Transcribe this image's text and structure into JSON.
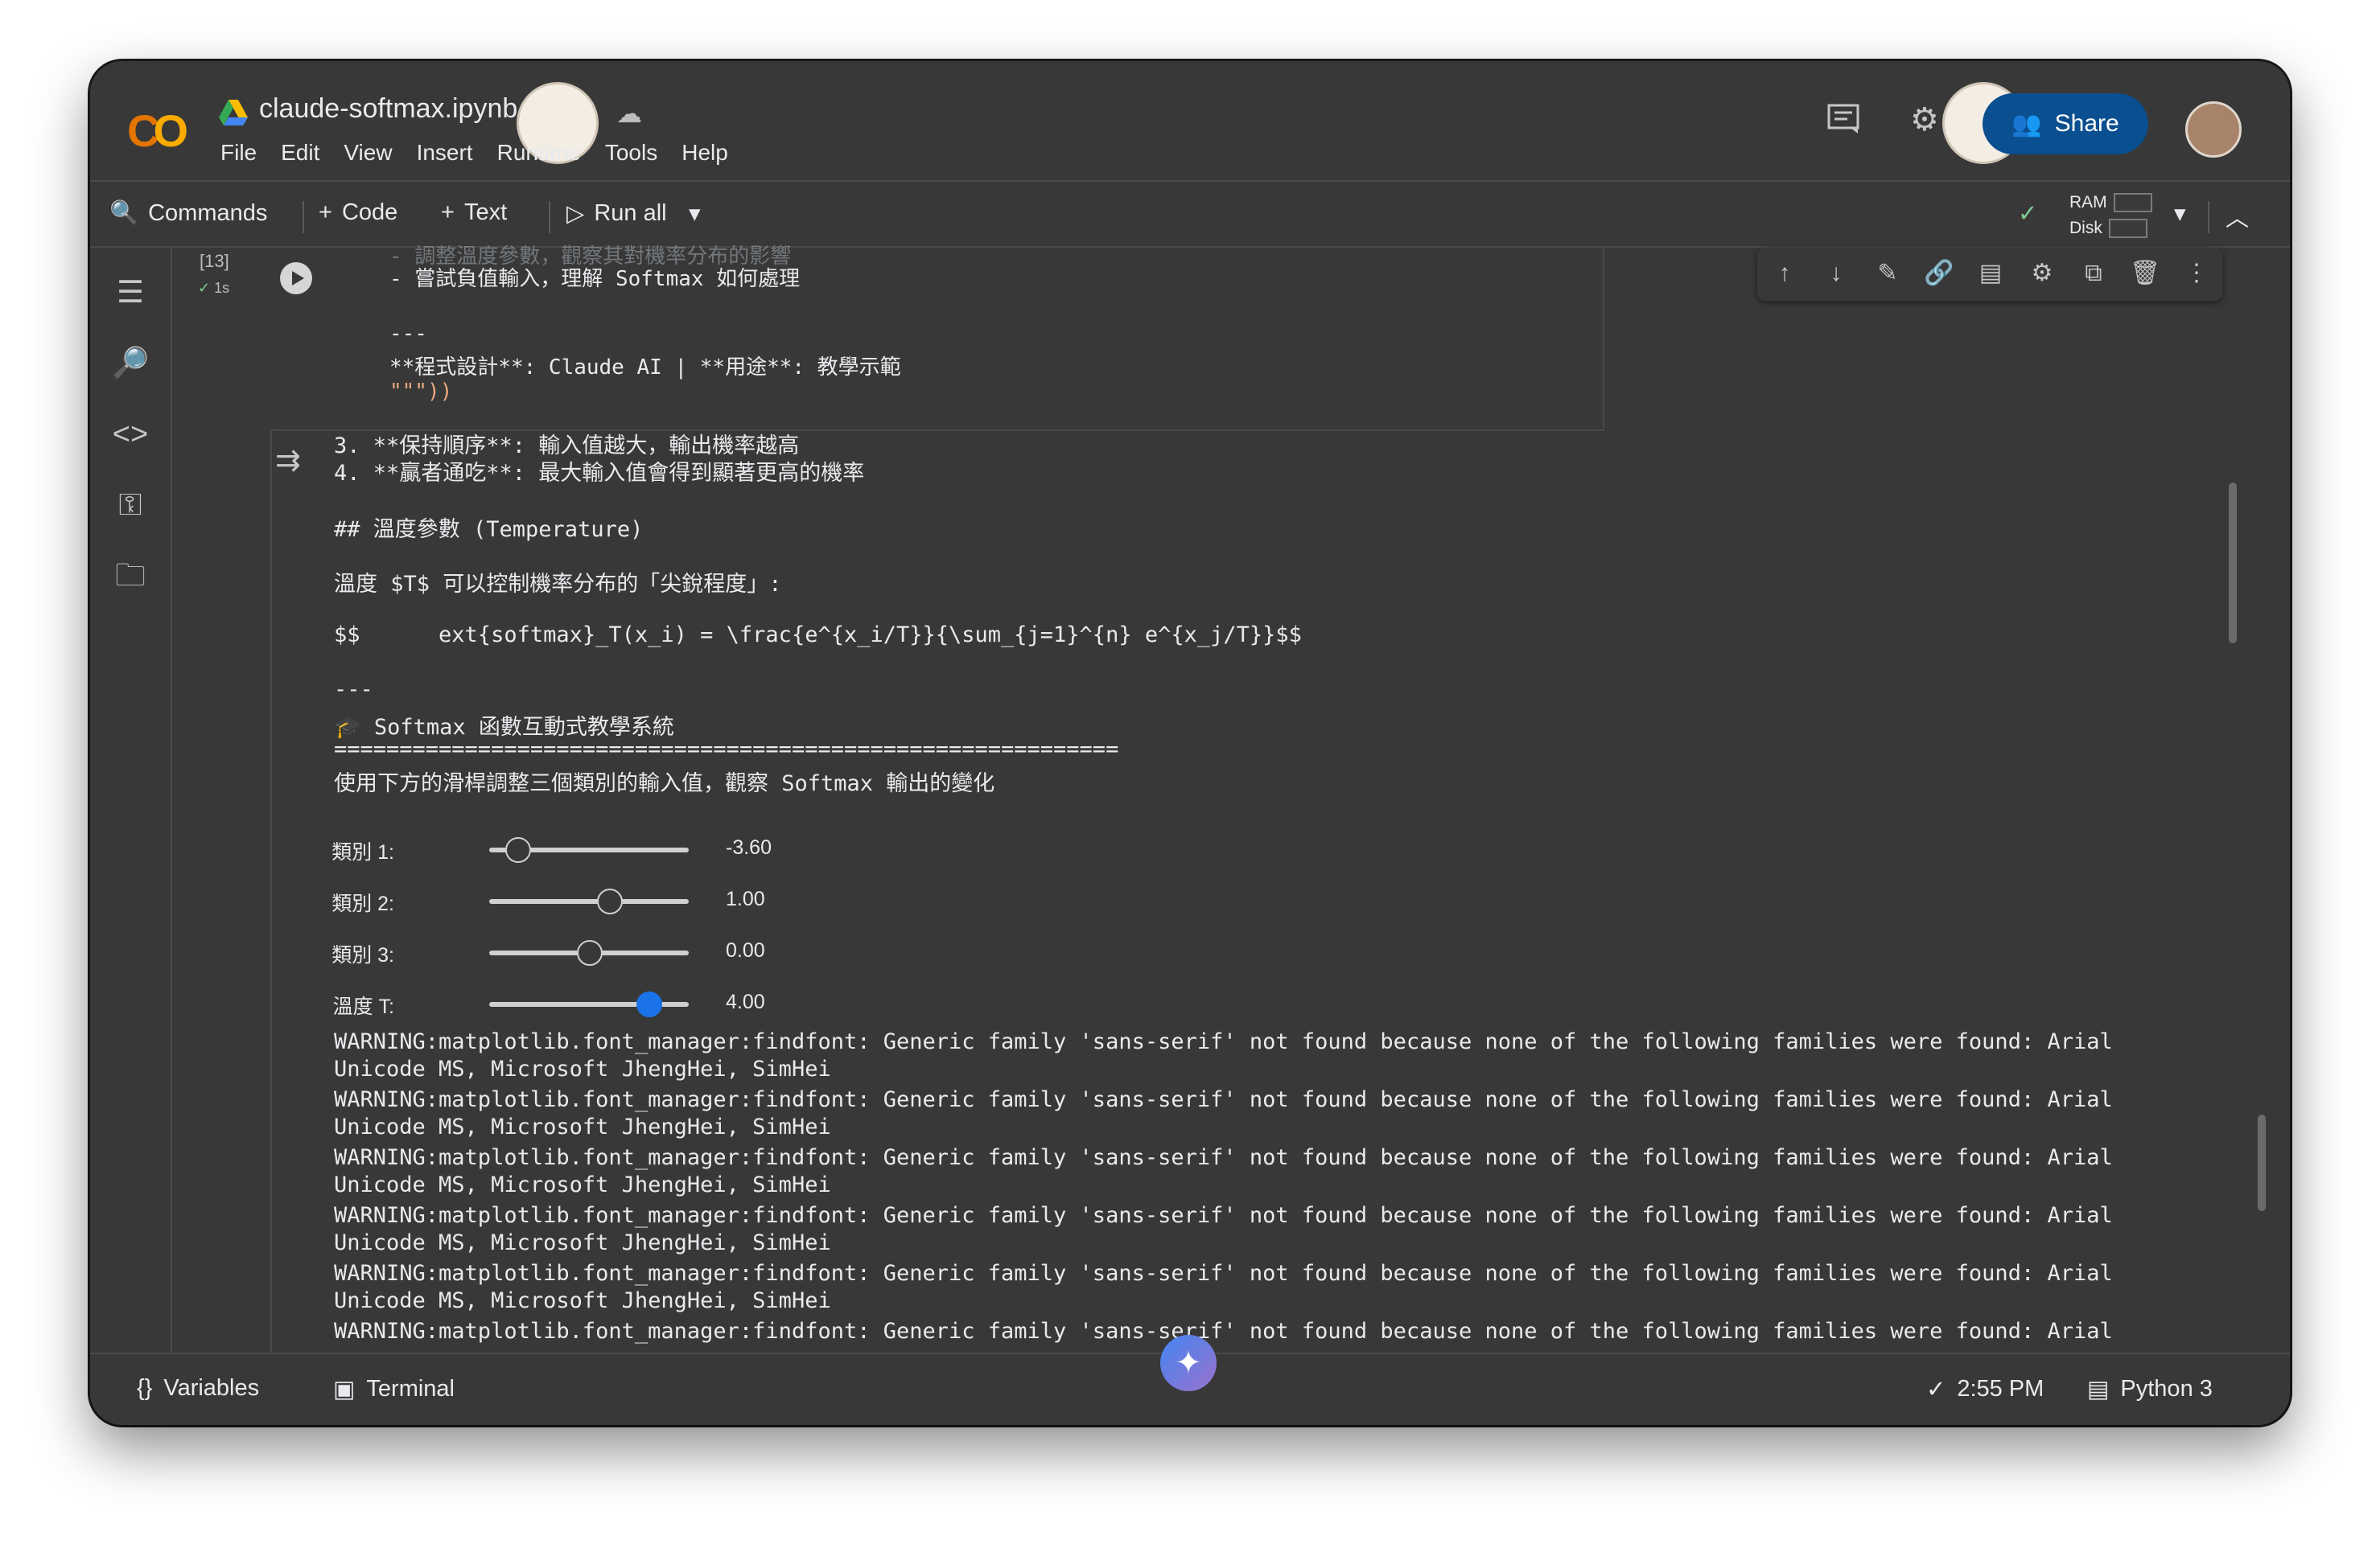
{
  "header": {
    "filename": "claude-softmax.ipynb",
    "menu": [
      "File",
      "Edit",
      "View",
      "Insert",
      "Runtime",
      "Tools",
      "Help"
    ],
    "share_label": "Share"
  },
  "toolbar": {
    "commands": "Commands",
    "code": "Code",
    "text": "Text",
    "run_all": "Run all",
    "ram": "RAM",
    "disk": "Disk"
  },
  "cell": {
    "exec_count": "[13]",
    "exec_time": "1s",
    "code_lines": [
      "- 調整溫度參數，觀察其對機率分布的影響",
      "- 嘗試負值輸入，理解 Softmax 如何處理",
      "",
      "---",
      "**程式設計**: Claude AI | **用途**: 教學示範",
      "\"\"\"))"
    ]
  },
  "output": {
    "lines": [
      "3. **保持順序**: 輸入值越大，輸出機率越高",
      "4. **贏者通吃**: 最大輸入值會得到顯著更高的機率",
      "## 溫度參數 (Temperature)",
      "溫度 $T$ 可以控制機率分布的「尖銳程度」:",
      "$$      ext{softmax}_T(x_i) = \\frac{e^{x_i/T}}{\\sum_{j=1}^{n} e^{x_j/T}}$$",
      "---",
      "🎓 Softmax 函數互動式教學系統",
      "============================================================",
      "使用下方的滑桿調整三個類別的輸入值，觀察 Softmax 輸出的變化"
    ],
    "sliders": [
      {
        "label": "類別 1:",
        "value": "-3.60",
        "fraction": 0.14
      },
      {
        "label": "類別 2:",
        "value": "1.00",
        "fraction": 0.6
      },
      {
        "label": "類別 3:",
        "value": "0.00",
        "fraction": 0.5
      },
      {
        "label": "溫度 T:",
        "value": "4.00",
        "fraction": 0.8
      }
    ],
    "warnings": [
      "WARNING:matplotlib.font_manager:findfont: Generic family 'sans-serif' not found because none of the following families were found: Arial",
      "Unicode MS, Microsoft JhengHei, SimHei",
      "WARNING:matplotlib.font_manager:findfont: Generic family 'sans-serif' not found because none of the following families were found: Arial",
      "Unicode MS, Microsoft JhengHei, SimHei",
      "WARNING:matplotlib.font_manager:findfont: Generic family 'sans-serif' not found because none of the following families were found: Arial",
      "Unicode MS, Microsoft JhengHei, SimHei",
      "WARNING:matplotlib.font_manager:findfont: Generic family 'sans-serif' not found because none of the following families were found: Arial",
      "Unicode MS, Microsoft JhengHei, SimHei",
      "WARNING:matplotlib.font_manager:findfont: Generic family 'sans-serif' not found because none of the following families were found: Arial",
      "Unicode MS, Microsoft JhengHei, SimHei",
      "WARNING:matplotlib.font_manager:findfont: Generic family 'sans-serif' not found because none of the following families were found: Arial"
    ]
  },
  "statusbar": {
    "variables": "Variables",
    "terminal": "Terminal",
    "time": "2:55 PM",
    "kernel": "Python 3"
  },
  "colors": {
    "background": "#383838",
    "accent": "#1a73e8",
    "share_button": "#0a4f8f",
    "success": "#81c995"
  }
}
